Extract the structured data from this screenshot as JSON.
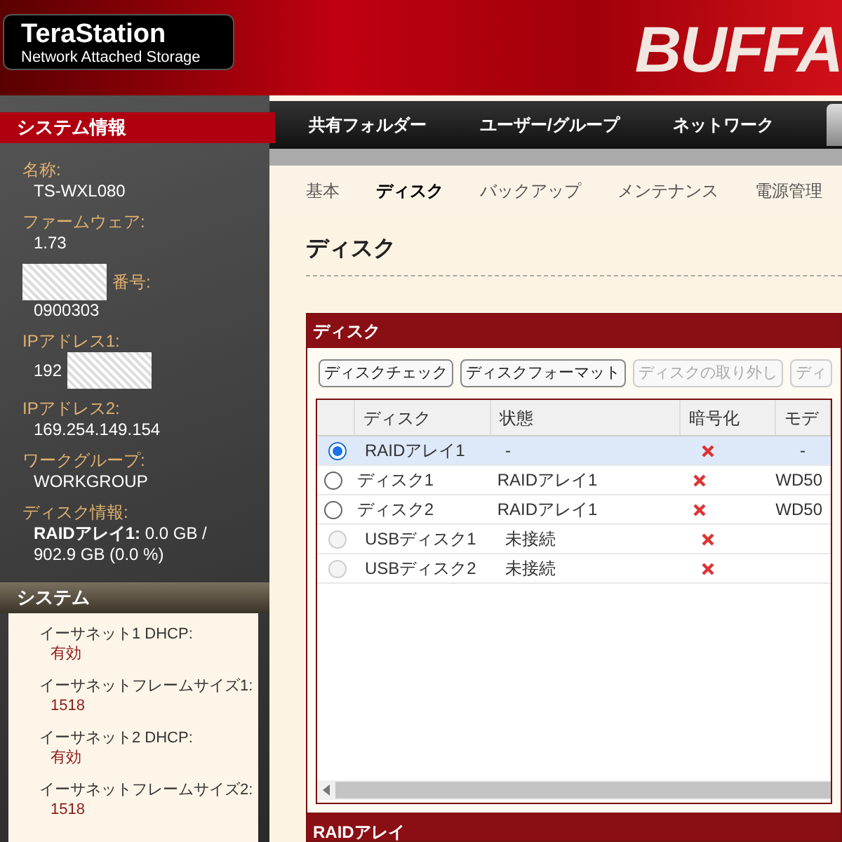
{
  "logo": {
    "title": "TeraStation",
    "subtitle": "Network Attached Storage"
  },
  "brand": "BUFFA",
  "sidebar": {
    "title": "システム情報",
    "fields": [
      {
        "kind": "plain",
        "label": "名称:",
        "value": "TS-WXL080"
      },
      {
        "kind": "plain",
        "label": "ファームウェア:",
        "value": "1.73"
      },
      {
        "kind": "masklabel",
        "label": "番号:",
        "value": "0900303"
      },
      {
        "kind": "maskvalue",
        "label": "IPアドレス1:",
        "value": "192"
      },
      {
        "kind": "plain",
        "label": "IPアドレス2:",
        "value": "169.254.149.154"
      },
      {
        "kind": "plain",
        "label": "ワークグループ:",
        "value": "WORKGROUP"
      },
      {
        "kind": "plain",
        "label": "ディスク情報:",
        "value": "**RAIDアレイ1:** 0.0 GB / 902.9 GB (0.0 %)"
      }
    ],
    "system_title": "システム",
    "system_fields": [
      {
        "label": "イーサネット1 DHCP:",
        "value": "有効"
      },
      {
        "label": "イーサネットフレームサイズ1:",
        "value": "1518"
      },
      {
        "label": "イーサネット2 DHCP:",
        "value": "有効"
      },
      {
        "label": "イーサネットフレームサイズ2:",
        "value": "1518"
      }
    ]
  },
  "nav": [
    {
      "label": "共有フォルダー",
      "selected": false
    },
    {
      "label": "ユーザー/グループ",
      "selected": false
    },
    {
      "label": "ネットワーク",
      "selected": false
    },
    {
      "selected": true
    }
  ],
  "subnav": [
    {
      "label": "基本",
      "selected": false
    },
    {
      "label": "ディスク",
      "selected": true
    },
    {
      "label": "バックアップ",
      "selected": false
    },
    {
      "label": "メンテナンス",
      "selected": false
    },
    {
      "label": "電源管理",
      "selected": false
    }
  ],
  "page_title": "ディスク",
  "panel": {
    "title": "ディスク",
    "buttons": [
      {
        "label": "ディスクチェック",
        "disabled": false
      },
      {
        "label": "ディスクフォーマット",
        "disabled": false
      },
      {
        "label": "ディスクの取り外し",
        "disabled": true
      },
      {
        "label": "ディ",
        "disabled": true
      }
    ],
    "columns": [
      "ディスク",
      "状態",
      "暗号化",
      "モデ"
    ],
    "rows": [
      {
        "selected": true,
        "disabled": false,
        "disk": "RAIDアレイ1",
        "status": "-",
        "encrypted": false,
        "model": "-"
      },
      {
        "selected": false,
        "disabled": false,
        "disk": "ディスク1",
        "status": "RAIDアレイ1",
        "encrypted": false,
        "model": "WD50"
      },
      {
        "selected": false,
        "disabled": false,
        "disk": "ディスク2",
        "status": "RAIDアレイ1",
        "encrypted": false,
        "model": "WD50"
      },
      {
        "selected": false,
        "disabled": true,
        "disk": "USBディスク1",
        "status": "未接続",
        "encrypted": false
      },
      {
        "selected": false,
        "disabled": true,
        "disk": "USBディスク2",
        "status": "未接続",
        "encrypted": false
      }
    ]
  },
  "next_panel": {
    "title": "RAIDアレイ"
  }
}
